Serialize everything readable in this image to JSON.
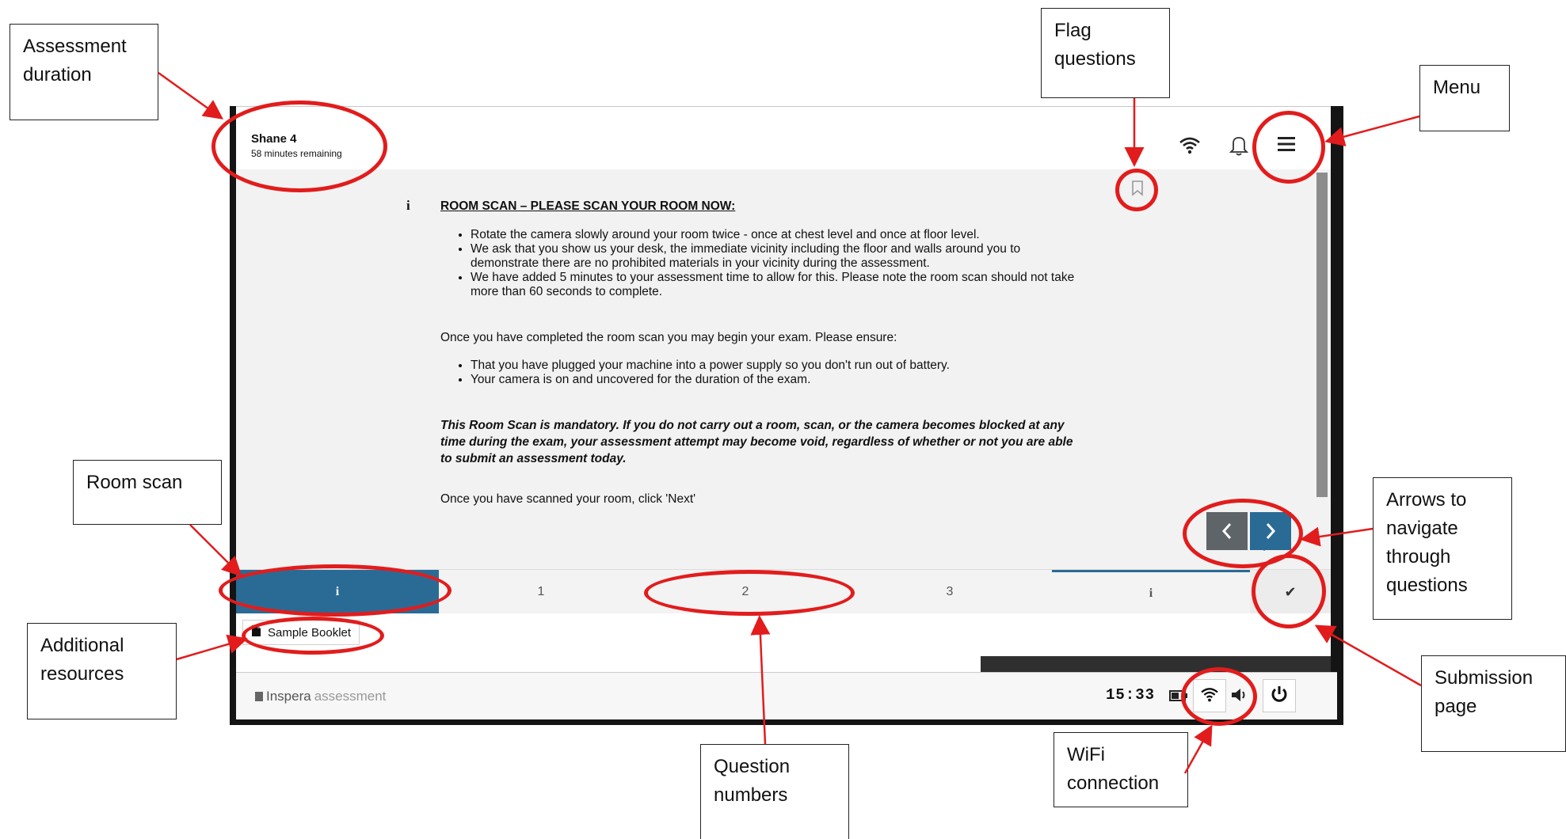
{
  "callouts": {
    "assessment_duration": "Assessment\nduration",
    "flag_questions": "Flag\nquestions",
    "menu": "Menu",
    "room_scan": "Room scan",
    "additional_resources": "Additional\nresources",
    "arrows": "Arrows to\nnavigate\nthrough\nquestions",
    "submission_page": "Submission\npage",
    "wifi_connection": "WiFi\nconnection",
    "question_numbers": "Question\nnumbers"
  },
  "header": {
    "candidate_name": "Shane 4",
    "time_remaining": "58 minutes remaining"
  },
  "content": {
    "info_glyph": "i",
    "heading": "ROOM SCAN – PLEASE SCAN YOUR ROOM NOW:",
    "list1": [
      "Rotate the camera slowly around your room twice - once at chest level and once at floor level.",
      "We ask that you show us your desk, the immediate vicinity including the floor and walls around you to demonstrate there are no prohibited materials in your vicinity during the assessment.",
      "We have added 5 minutes to your assessment time to allow for this. Please note the room scan should not take more than 60 seconds to complete."
    ],
    "para1": "Once you have completed the room scan you may begin your exam. Please ensure:",
    "list2": [
      "That you have plugged your machine into a power supply so you don't run out of battery.",
      "Your camera is on and uncovered for the duration of the exam."
    ],
    "warning": "This Room Scan is mandatory. If you do not carry out a room, scan, or the camera becomes blocked at any time during the exam, your assessment attempt may become void, regardless of whether or not you are able to submit an assessment today.",
    "para2": "Once you have scanned your room, click 'Next'"
  },
  "question_bar": {
    "tabs": [
      "i",
      "1",
      "2",
      "3",
      "i"
    ],
    "submit_glyph": "✔"
  },
  "resources": {
    "booklet_label": "Sample Booklet"
  },
  "taskbar": {
    "brand": "Inspera",
    "brand_suffix": "assessment",
    "clock": "15:33"
  },
  "colors": {
    "accent_blue": "#2a6b96",
    "annotation_red": "#e21c1c",
    "nav_prev_bg": "#5f6469"
  }
}
